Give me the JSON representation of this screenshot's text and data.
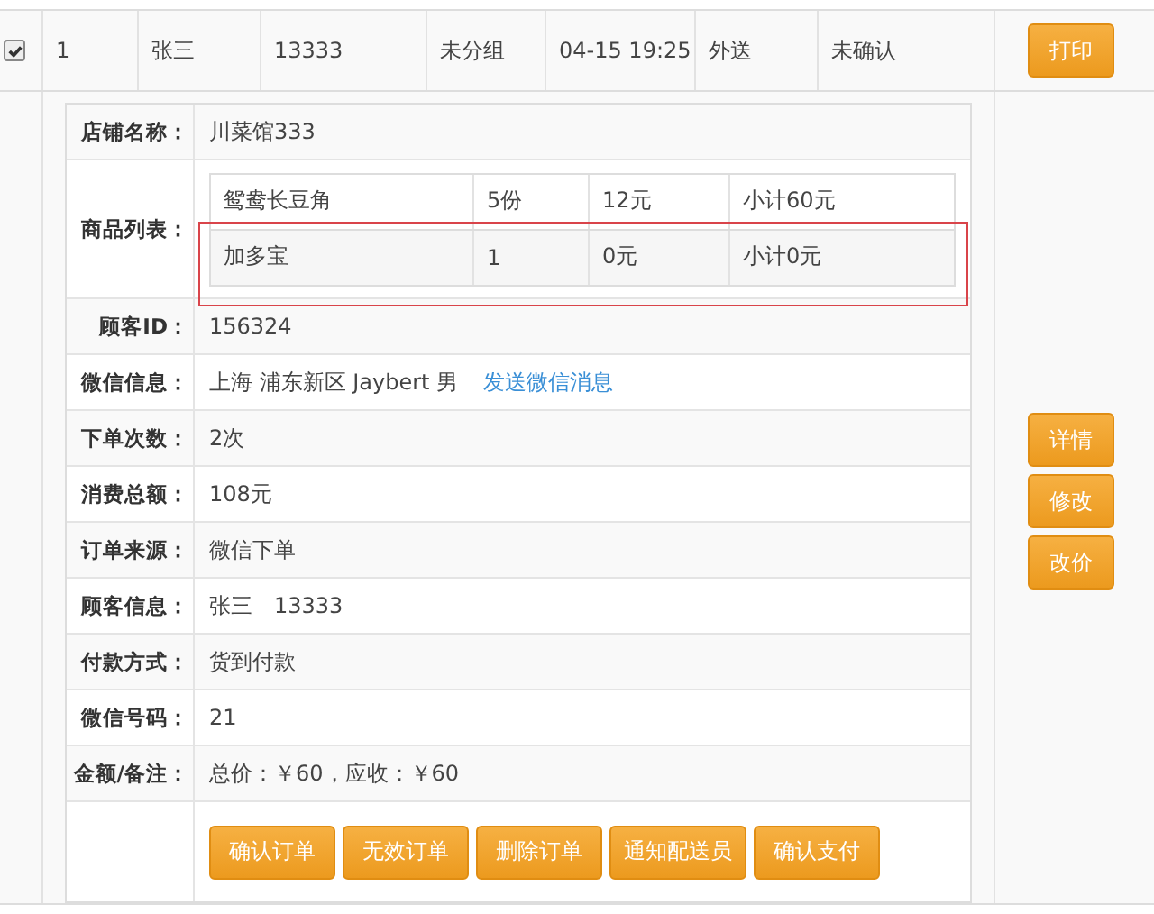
{
  "order": {
    "checked": true,
    "cells": [
      "1",
      "张三",
      "13333",
      "未分组",
      "04-15 19:25",
      "外送",
      "未确认"
    ],
    "print_button": "打印"
  },
  "details": {
    "rows": [
      {
        "kind": "text",
        "label": "店铺名称：",
        "value": "川菜馆333"
      },
      {
        "kind": "goods",
        "label": "商品列表：",
        "items": [
          {
            "name": "鸳鸯长豆角",
            "qty": "5份",
            "price": "12元",
            "subtotal": "小计60元",
            "highlighted": false
          },
          {
            "name": "加多宝",
            "qty": "1",
            "price": "0元",
            "subtotal": "小计0元",
            "highlighted": true
          }
        ]
      },
      {
        "kind": "text",
        "label": "顾客ID：",
        "value": "156324"
      },
      {
        "kind": "link",
        "label": "微信信息：",
        "value": "上海 浦东新区 Jaybert 男",
        "link": "发送微信消息"
      },
      {
        "kind": "text",
        "label": "下单次数：",
        "value": "2次"
      },
      {
        "kind": "text",
        "label": "消费总额：",
        "value": "108元"
      },
      {
        "kind": "text",
        "label": "订单来源：",
        "value": "微信下单"
      },
      {
        "kind": "text",
        "label": "顾客信息：",
        "value": "张三　13333"
      },
      {
        "kind": "text",
        "label": "付款方式：",
        "value": "货到付款"
      },
      {
        "kind": "text",
        "label": "微信号码：",
        "value": "21"
      },
      {
        "kind": "text",
        "label": "金额/备注：",
        "value": "总价：￥60，应收：￥60"
      }
    ],
    "actions": [
      "确认订单",
      "无效订单",
      "删除订单",
      "通知配送员",
      "确认支付"
    ]
  },
  "side_buttons": [
    "详情",
    "修改",
    "改价"
  ]
}
